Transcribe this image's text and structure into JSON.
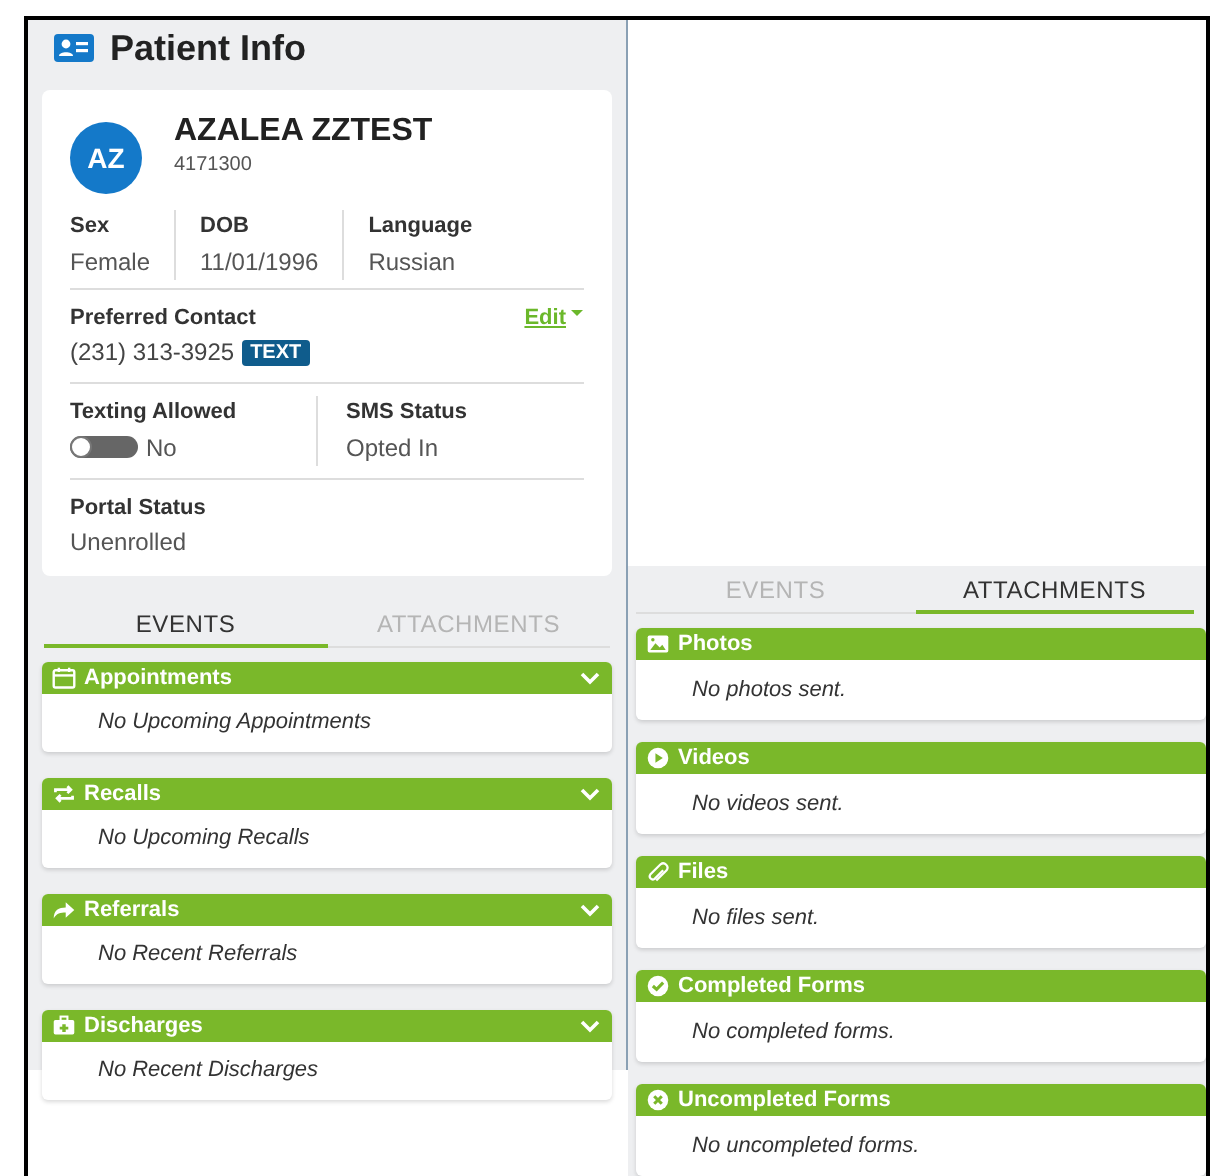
{
  "header": {
    "title": "Patient Info"
  },
  "patient": {
    "initials": "AZ",
    "name": "AZALEA ZZTEST",
    "id": "4171300"
  },
  "demographics": [
    {
      "label": "Sex",
      "value": "Female"
    },
    {
      "label": "DOB",
      "value": "11/01/1996"
    },
    {
      "label": "Language",
      "value": "Russian"
    }
  ],
  "preferred_contact": {
    "label": "Preferred Contact",
    "value": "(231) 313-3925",
    "badge": "TEXT",
    "edit": "Edit"
  },
  "texting": {
    "label": "Texting Allowed",
    "on": false,
    "value": "No"
  },
  "sms": {
    "label": "SMS Status",
    "value": "Opted In"
  },
  "portal": {
    "label": "Portal Status",
    "value": "Unenrolled"
  },
  "left_tabs": [
    {
      "label": "EVENTS",
      "selected": true
    },
    {
      "label": "ATTACHMENTS",
      "selected": false
    }
  ],
  "left_sections": [
    {
      "kind": "calendar",
      "title": "Appointments",
      "empty": "No Upcoming Appointments"
    },
    {
      "kind": "recall",
      "title": "Recalls",
      "empty": "No Upcoming Recalls"
    },
    {
      "kind": "share",
      "title": "Referrals",
      "empty": "No Recent Referrals"
    },
    {
      "kind": "hospital",
      "title": "Discharges",
      "empty": "No Recent Discharges"
    }
  ],
  "right_tabs": [
    {
      "label": "EVENTS",
      "selected": false
    },
    {
      "label": "ATTACHMENTS",
      "selected": true
    }
  ],
  "right_sections": [
    {
      "kind": "photo",
      "title": "Photos",
      "empty": "No photos sent."
    },
    {
      "kind": "video",
      "title": "Videos",
      "empty": "No videos sent."
    },
    {
      "kind": "clip",
      "title": "Files",
      "empty": "No files sent."
    },
    {
      "kind": "check",
      "title": "Completed Forms",
      "empty": "No completed forms."
    },
    {
      "kind": "cross",
      "title": "Uncompleted Forms",
      "empty": "No uncompleted forms."
    }
  ]
}
